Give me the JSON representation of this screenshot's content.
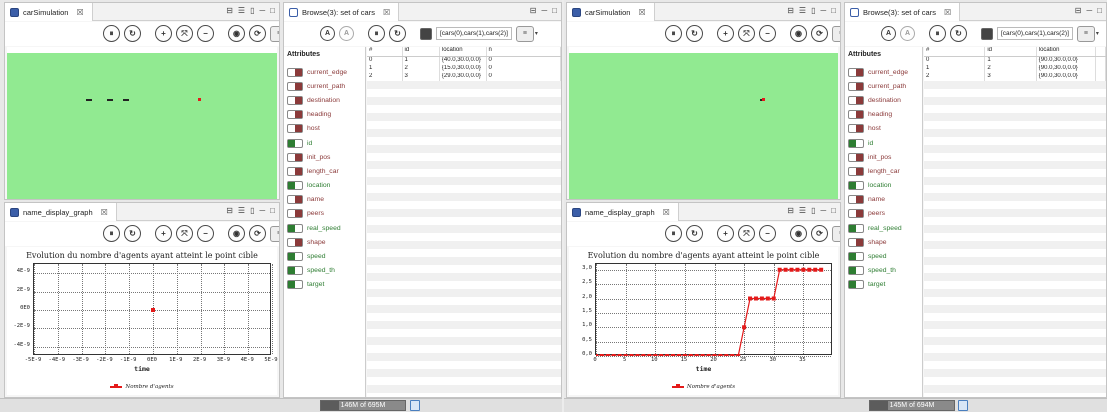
{
  "colors": {
    "sim_green": "#91ea91",
    "series_red": "#e41a1a",
    "attr_off": "#8b3a3a",
    "attr_on": "#2e7d32"
  },
  "icons": [
    "pause-icon",
    "step-icon",
    "zoom-in-icon",
    "fit-icon",
    "zoom-out-icon",
    "camera-icon",
    "sync-icon",
    "layers-icon",
    "lock-icon",
    "trash-icon"
  ],
  "left": {
    "sim_tab": {
      "title": "carSimulation",
      "close": "☒"
    },
    "graph_tab": {
      "title": "name_display_graph",
      "close": "☒"
    },
    "browse_tab": {
      "title": "Browse(3): set of cars",
      "close": "☒"
    },
    "query": "[cars(0),cars(1),cars(2)]",
    "attributes_header": "Attributes",
    "chart_data": {
      "type": "line",
      "title": "Evolution du nombre d'agents ayant atteint le point cible",
      "xlabel": "time",
      "ylabel": "",
      "x_ticks": [
        "-5E-9",
        "-4E-9",
        "-3E-9",
        "-2E-9",
        "-1E-9",
        "0E0",
        "1E-9",
        "2E-9",
        "3E-9",
        "4E-9",
        "5E-9"
      ],
      "y_ticks": [
        "4E-9",
        "2E-9",
        "0E0",
        "-2E-9",
        "-4E-9"
      ],
      "xlim": [
        -5e-09,
        5e-09
      ],
      "ylim": [
        -5e-09,
        5e-09
      ],
      "series": [
        {
          "name": "Nombre d'agents",
          "x": [
            0
          ],
          "y": [
            0
          ]
        }
      ]
    },
    "table": {
      "headers": [
        "#",
        "id",
        "location",
        "n"
      ],
      "rows": [
        [
          "0",
          "1",
          "{40.0,30.0,0.0}",
          "0"
        ],
        [
          "1",
          "2",
          "{15.0,30.0,0.0}",
          "0"
        ],
        [
          "2",
          "3",
          "{29.0,30.0,0.0}",
          "0"
        ]
      ]
    },
    "memory": "146M of 695M",
    "memory_used_fraction": 0.21
  },
  "right": {
    "sim_tab": {
      "title": "carSimulation",
      "close": "☒"
    },
    "graph_tab": {
      "title": "name_display_graph",
      "close": "☒"
    },
    "browse_tab": {
      "title": "Browse(3): set of cars",
      "close": "☒"
    },
    "query": "[cars(0),cars(1),cars(2)]",
    "attributes_header": "Attributes",
    "chart_data": {
      "type": "line",
      "title": "Evolution du nombre d'agents ayant atteint le point cible",
      "xlabel": "time",
      "ylabel": "",
      "x_ticks": [
        "0",
        "5",
        "10",
        "15",
        "20",
        "25",
        "30",
        "35"
      ],
      "y_ticks": [
        "3,0",
        "2,5",
        "2,0",
        "1,5",
        "1,0",
        "0,5",
        "0,0"
      ],
      "xlim": [
        0,
        40
      ],
      "ylim": [
        0,
        3.2
      ],
      "series": [
        {
          "name": "Nombre d'agents",
          "x": [
            0,
            1,
            2,
            3,
            4,
            5,
            6,
            7,
            8,
            9,
            10,
            11,
            12,
            13,
            14,
            15,
            16,
            17,
            18,
            19,
            20,
            21,
            22,
            23,
            24,
            25,
            26,
            27,
            28,
            29,
            30,
            31,
            32,
            33,
            34,
            35,
            36,
            37,
            38
          ],
          "y": [
            0,
            0,
            0,
            0,
            0,
            0,
            0,
            0,
            0,
            0,
            0,
            0,
            0,
            0,
            0,
            0,
            0,
            0,
            0,
            0,
            0,
            0,
            0,
            0,
            0,
            1,
            2,
            2,
            2,
            2,
            2,
            3,
            3,
            3,
            3,
            3,
            3,
            3,
            3
          ]
        }
      ]
    },
    "table": {
      "headers": [
        "#",
        "id",
        "location",
        ""
      ],
      "rows": [
        [
          "0",
          "1",
          "{90.0,30.0,0.0}",
          ""
        ],
        [
          "1",
          "2",
          "{90.0,30.0,0.0}",
          ""
        ],
        [
          "2",
          "3",
          "{90.0,30.0,0.0}",
          ""
        ]
      ]
    },
    "memory": "145M of 694M",
    "memory_used_fraction": 0.21
  },
  "attributes": [
    {
      "label": "current_edge",
      "on": false
    },
    {
      "label": "current_path",
      "on": false
    },
    {
      "label": "destination",
      "on": false
    },
    {
      "label": "heading",
      "on": false
    },
    {
      "label": "host",
      "on": false
    },
    {
      "label": "id",
      "on": true
    },
    {
      "label": "init_pos",
      "on": false
    },
    {
      "label": "length_car",
      "on": false
    },
    {
      "label": "location",
      "on": true
    },
    {
      "label": "name",
      "on": false
    },
    {
      "label": "peers",
      "on": false
    },
    {
      "label": "real_speed",
      "on": true
    },
    {
      "label": "shape",
      "on": false
    },
    {
      "label": "speed",
      "on": true
    },
    {
      "label": "speed_th",
      "on": true
    },
    {
      "label": "target",
      "on": true
    }
  ]
}
